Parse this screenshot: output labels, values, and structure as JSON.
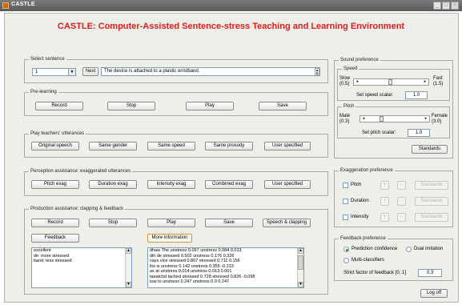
{
  "window": {
    "title": "CASTLE",
    "min": "_",
    "max": "□",
    "close": "×"
  },
  "app_title": "CASTLE:  Computer-Assisted Sentence-stress Teaching and Learning Environment",
  "select_sentence": {
    "legend": "Select sentence",
    "number": "1",
    "next_label": "Next",
    "sentence": "The device is attached to a plastic wristband."
  },
  "pre_learning": {
    "legend": "Pre-learning",
    "buttons": [
      "Record",
      "Stop",
      "Play",
      "Save"
    ]
  },
  "play_teachers": {
    "legend": "Play teachers' utterances",
    "buttons": [
      "Original speech",
      "Same gender",
      "Same speed",
      "Same prosody",
      "User specified"
    ]
  },
  "perception": {
    "legend": "Perception assistance: exaggerated utterances",
    "buttons": [
      "Pitch exag",
      "Duration exag",
      "Intensity exag",
      "Combined exag",
      "User specified"
    ]
  },
  "production": {
    "legend": "Production assistance: clapping & feedback",
    "buttons": [
      "Record",
      "Stop",
      "Play",
      "Save",
      "Speech & clapping"
    ],
    "feedback_label": "Feedback",
    "more_info_label": "More information",
    "legend_list": [
      "excellent",
      "de: more stressed",
      "band: less stressed"
    ],
    "info_list": [
      "dhaw The unstress 0.097 unstress 0.084 0.013",
      "dih de stressed 0.502 unstress 0.176 0.326",
      "vays vice stressed 0.867 stressed 0.711 0.156",
      "ihz is unstress 0.142 unstress 0.355 -0.213",
      "ax at unstress 0.014 unstress 0.013 0.001",
      "taeatchd tached stressed 0.728 stressed 0.826 -0.098",
      "tuw to unstress 0.247 unstress 0.0 0.247"
    ]
  },
  "sound_preference": {
    "legend": "Sound preference",
    "speed": {
      "legend": "Speed",
      "left_label": "Slow",
      "left_value": "(0.5)",
      "right_label": "Fast",
      "right_value": "(1.5)",
      "scalar_label": "Set speed scalar:",
      "scalar_value": "1.0",
      "level": 0.5
    },
    "pitch": {
      "legend": "Pitch",
      "left_label": "Male",
      "left_value": "(0.3)",
      "right_label": "Female",
      "right_value": "(3.0)",
      "scalar_label": "Set pitch scalar:",
      "scalar_value": "1.0",
      "level": 0.26
    },
    "standards_label": "Standards"
  },
  "exaggeration": {
    "legend": "Exaggeration preference",
    "rows": [
      {
        "label": "Pitch",
        "plus": "+",
        "minus": "-",
        "standards": "Standards"
      },
      {
        "label": "Duration",
        "plus": "+",
        "minus": "-",
        "standards": "Standards"
      },
      {
        "label": "Intensity",
        "plus": "+",
        "minus": "-",
        "standards": "Standards"
      }
    ]
  },
  "feedback_pref": {
    "legend": "Feedback preference",
    "option1": "Prediction confidence",
    "option2": "Dual imitation",
    "option3": "Multi-classifiers",
    "strict_label": "Strict factor of feedback [0, 1]",
    "strict_value": "0.3"
  },
  "logoff_label": "Log off"
}
